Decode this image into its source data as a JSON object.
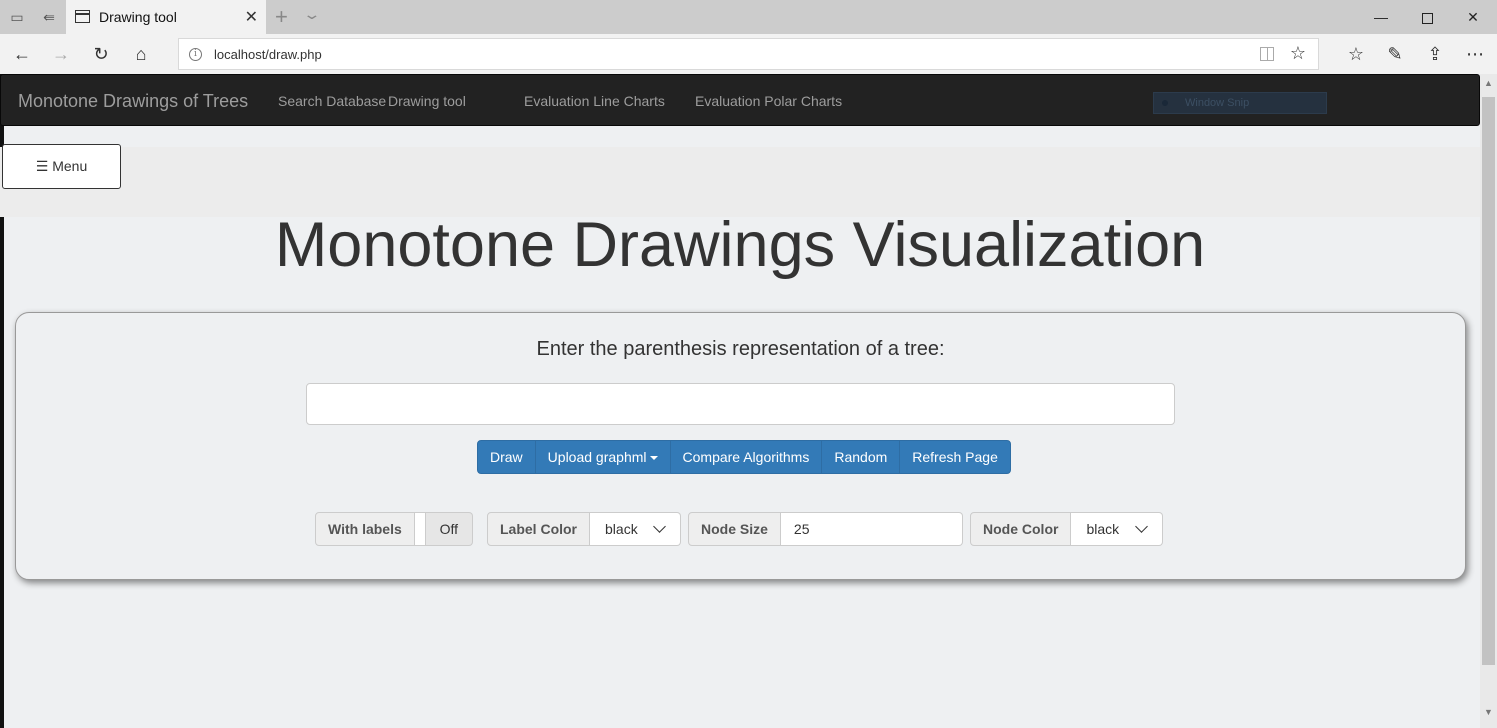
{
  "browser": {
    "tab_title": "Drawing tool",
    "url": "localhost/draw.php"
  },
  "site": {
    "brand": "Monotone Drawings of Trees",
    "nav_links": [
      "Search Database",
      "Drawing tool",
      "Evaluation Line Charts",
      "Evaluation Polar Charts"
    ],
    "overlay_label": "Window Snip"
  },
  "page": {
    "menu_label": "☰ Menu",
    "title": "Monotone Drawings Visualization",
    "prompt": "Enter the parenthesis representation of a tree:",
    "tree_input_value": ""
  },
  "buttons": {
    "draw": "Draw",
    "upload": "Upload graphml",
    "compare": "Compare Algorithms",
    "random": "Random",
    "refresh": "Refresh Page"
  },
  "options": {
    "with_labels": {
      "label": "With labels",
      "state": "Off"
    },
    "label_color": {
      "label": "Label Color",
      "value": "black"
    },
    "node_size": {
      "label": "Node Size",
      "value": "25"
    },
    "node_color": {
      "label": "Node Color",
      "value": "black"
    }
  },
  "colors": {
    "navbar_bg": "#222222",
    "primary_button": "#337ab7",
    "page_bg": "#eef0f2"
  }
}
